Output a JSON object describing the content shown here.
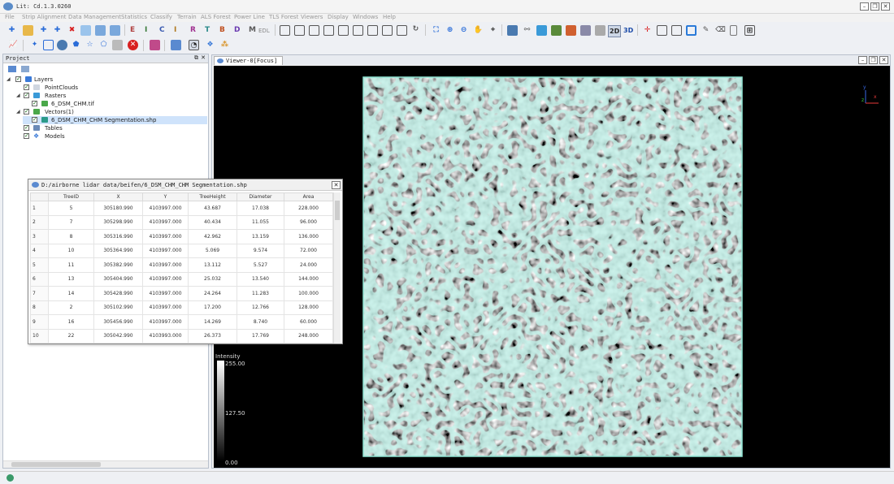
{
  "window": {
    "title": "Lit: Cd.1.3.0260"
  },
  "menu": [
    "File",
    "Strip Alignment",
    "Data Management",
    "Statistics",
    "Classify",
    "Terrain",
    "ALS Forest",
    "Power Line",
    "TLS Forest",
    "Viewers",
    "Display",
    "Windows",
    "Help"
  ],
  "toolbar": {
    "class_letters": [
      "E",
      "I",
      "C",
      "I",
      "R",
      "T",
      "B",
      "D",
      "M",
      "EDL"
    ],
    "view_2d": "2D",
    "view_3d": "3D"
  },
  "project": {
    "title": "Project",
    "tree": [
      {
        "label": "Layers"
      },
      {
        "label": "PointClouds"
      },
      {
        "label": "Rasters"
      },
      {
        "label": "6_DSM_CHM.tif"
      },
      {
        "label": "Vectors(1)"
      },
      {
        "label": "6_DSM_CHM_CHM Segmentation.shp"
      },
      {
        "label": "Tables"
      },
      {
        "label": "Models"
      }
    ]
  },
  "viewer": {
    "tab_title": "Viewer-0[Focus]"
  },
  "legend": {
    "title": "Intensity",
    "max": "255.00",
    "mid": "127.50",
    "min": "0.00"
  },
  "axes_gizmo": {
    "x": "x",
    "y": "y",
    "z": "z"
  },
  "attribute_table": {
    "title": "D:/airborne lidar data/beifen/6_DSM_CHM_CHM Segmentation.shp",
    "columns": [
      "",
      "TreeID",
      "X",
      "Y",
      "TreeHeight",
      "Diameter",
      "Area"
    ],
    "rows": [
      [
        "1",
        "5",
        "305180.990",
        "4103997.000",
        "43.687",
        "17.038",
        "228.000"
      ],
      [
        "2",
        "7",
        "305298.990",
        "4103997.000",
        "40.434",
        "11.055",
        "96.000"
      ],
      [
        "3",
        "8",
        "305316.990",
        "4103997.000",
        "42.962",
        "13.159",
        "136.000"
      ],
      [
        "4",
        "10",
        "305364.990",
        "4103997.000",
        "5.069",
        "9.574",
        "72.000"
      ],
      [
        "5",
        "11",
        "305382.990",
        "4103997.000",
        "13.112",
        "5.527",
        "24.000"
      ],
      [
        "6",
        "13",
        "305404.990",
        "4103997.000",
        "25.032",
        "13.540",
        "144.000"
      ],
      [
        "7",
        "14",
        "305428.990",
        "4103997.000",
        "24.264",
        "11.283",
        "100.000"
      ],
      [
        "8",
        "2",
        "305102.990",
        "4103997.000",
        "17.200",
        "12.766",
        "128.000"
      ],
      [
        "9",
        "16",
        "305456.990",
        "4103997.000",
        "14.269",
        "8.740",
        "60.000"
      ],
      [
        "10",
        "22",
        "305042.990",
        "4103993.000",
        "26.373",
        "17.769",
        "248.000"
      ]
    ]
  },
  "colors": {
    "segment_outline": "#8fe3d2",
    "viewer_background": "#000000",
    "selection": "#cfe3fb"
  }
}
